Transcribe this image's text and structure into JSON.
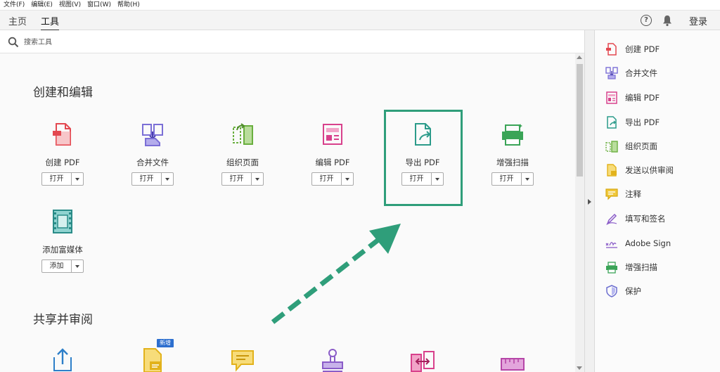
{
  "menu": [
    "文件(F)",
    "编辑(E)",
    "视图(V)",
    "窗口(W)",
    "帮助(H)"
  ],
  "tabs": {
    "home": "主页",
    "tools": "工具"
  },
  "header": {
    "help": "?",
    "login": "登录"
  },
  "search": {
    "placeholder": "搜索工具"
  },
  "sections": {
    "create_edit": "创建和编辑",
    "share_review": "共享并审阅"
  },
  "tools_row1": [
    {
      "label": "创建 PDF",
      "action": "打开",
      "icon": "create-pdf-icon"
    },
    {
      "label": "合并文件",
      "action": "打开",
      "icon": "combine-files-icon"
    },
    {
      "label": "组织页面",
      "action": "打开",
      "icon": "organize-pages-icon"
    },
    {
      "label": "编辑 PDF",
      "action": "打开",
      "icon": "edit-pdf-icon"
    },
    {
      "label": "导出 PDF",
      "action": "打开",
      "icon": "export-pdf-icon"
    },
    {
      "label": "增强扫描",
      "action": "打开",
      "icon": "enhance-scan-icon"
    }
  ],
  "tools_row2": [
    {
      "label": "添加富媒体",
      "action": "添加",
      "icon": "rich-media-icon"
    }
  ],
  "badge_new": "新增",
  "right_panel": [
    {
      "label": "创建 PDF",
      "icon": "create-pdf-icon",
      "color": "#e34850"
    },
    {
      "label": "合并文件",
      "icon": "combine-files-icon",
      "color": "#7b6fd6"
    },
    {
      "label": "编辑 PDF",
      "icon": "edit-pdf-icon",
      "color": "#d8418c"
    },
    {
      "label": "导出 PDF",
      "icon": "export-pdf-icon",
      "color": "#2b9b8a"
    },
    {
      "label": "组织页面",
      "icon": "organize-pages-icon",
      "color": "#6aaf3f"
    },
    {
      "label": "发送以供审阅",
      "icon": "send-review-icon",
      "color": "#e2b21b"
    },
    {
      "label": "注释",
      "icon": "comment-icon",
      "color": "#e2b21b"
    },
    {
      "label": "填写和签名",
      "icon": "fill-sign-icon",
      "color": "#8a5cc8"
    },
    {
      "label": "Adobe Sign",
      "icon": "adobe-sign-icon",
      "color": "#8a5cc8"
    },
    {
      "label": "增强扫描",
      "icon": "enhance-scan-icon",
      "color": "#3aa457"
    },
    {
      "label": "保护",
      "icon": "protect-icon",
      "color": "#6d6fd0"
    }
  ]
}
